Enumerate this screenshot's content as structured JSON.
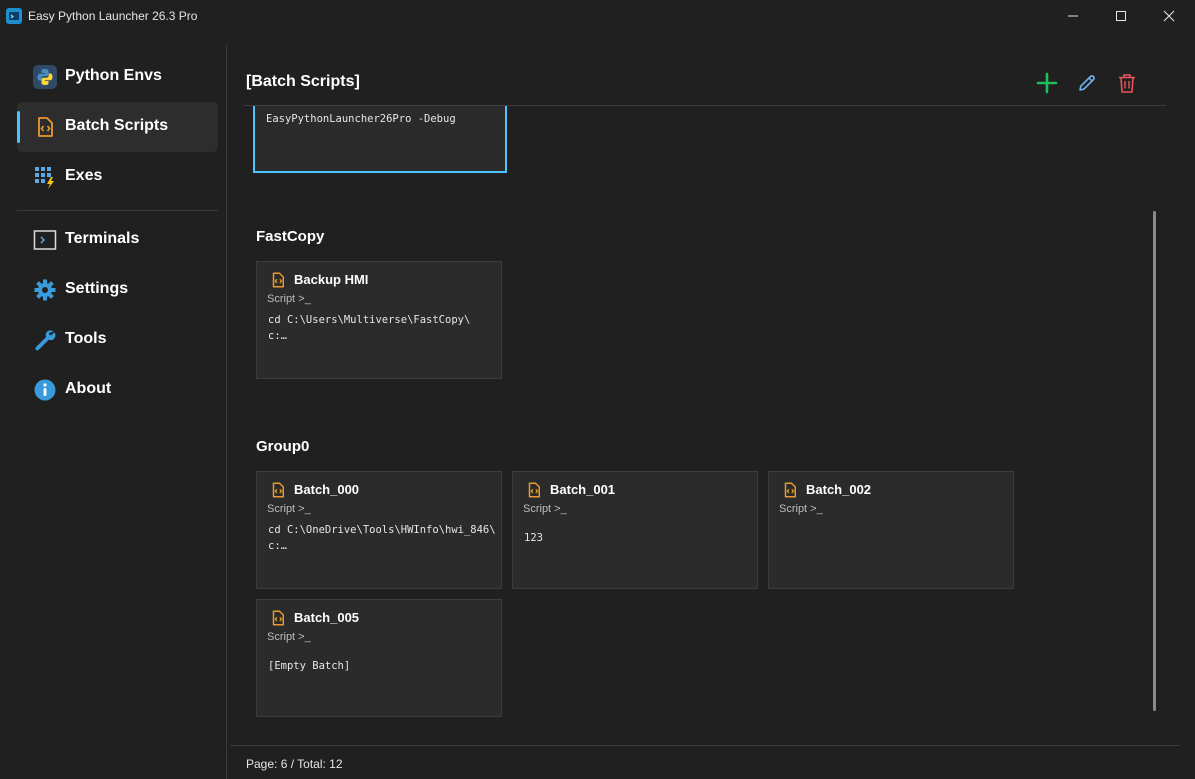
{
  "window": {
    "title": "Easy Python Launcher 26.3 Pro"
  },
  "sidebar": {
    "items": [
      {
        "label": "Python Envs",
        "icon": "python-icon"
      },
      {
        "label": "Batch Scripts",
        "icon": "batch-file-icon",
        "active": true
      },
      {
        "label": "Exes",
        "icon": "exe-grid-icon"
      },
      {
        "label": "Terminals",
        "icon": "terminal-icon"
      },
      {
        "label": "Settings",
        "icon": "gear-icon"
      },
      {
        "label": "Tools",
        "icon": "wrench-icon"
      },
      {
        "label": "About",
        "icon": "info-icon"
      }
    ]
  },
  "header": {
    "title": "[Batch Scripts]",
    "actions": [
      {
        "name": "add",
        "icon": "plus-icon",
        "color": "#1fbf5a"
      },
      {
        "name": "edit",
        "icon": "pencil-icon",
        "color": "#6fb3f2"
      },
      {
        "name": "delete",
        "icon": "trash-icon",
        "color": "#e8565b"
      }
    ]
  },
  "colors": {
    "accent": "#4cc2ff",
    "file_icon": "#e89a2c",
    "background": "#202020",
    "card": "#2b2b2b"
  },
  "partial_card": {
    "body": "EasyPythonLauncher26Pro -Debug"
  },
  "groups": [
    {
      "title": "FastCopy",
      "cards": [
        {
          "title": "Backup HMI",
          "type": "Script >_",
          "body": "cd C:\\Users\\Multiverse\\FastCopy\\\nc:…"
        }
      ]
    },
    {
      "title": "Group0",
      "cards": [
        {
          "title": "Batch_000",
          "type": "Script >_",
          "body": "cd C:\\OneDrive\\Tools\\HWInfo\\hwi_846\\\nc:…"
        },
        {
          "title": "Batch_001",
          "type": "Script >_",
          "body": "123"
        },
        {
          "title": "Batch_002",
          "type": "Script >_",
          "body": ""
        },
        {
          "title": "Batch_005",
          "type": "Script >_",
          "body": "[Empty Batch]"
        }
      ]
    }
  ],
  "footer": {
    "page_text": "Page: 6 / Total: 12"
  }
}
